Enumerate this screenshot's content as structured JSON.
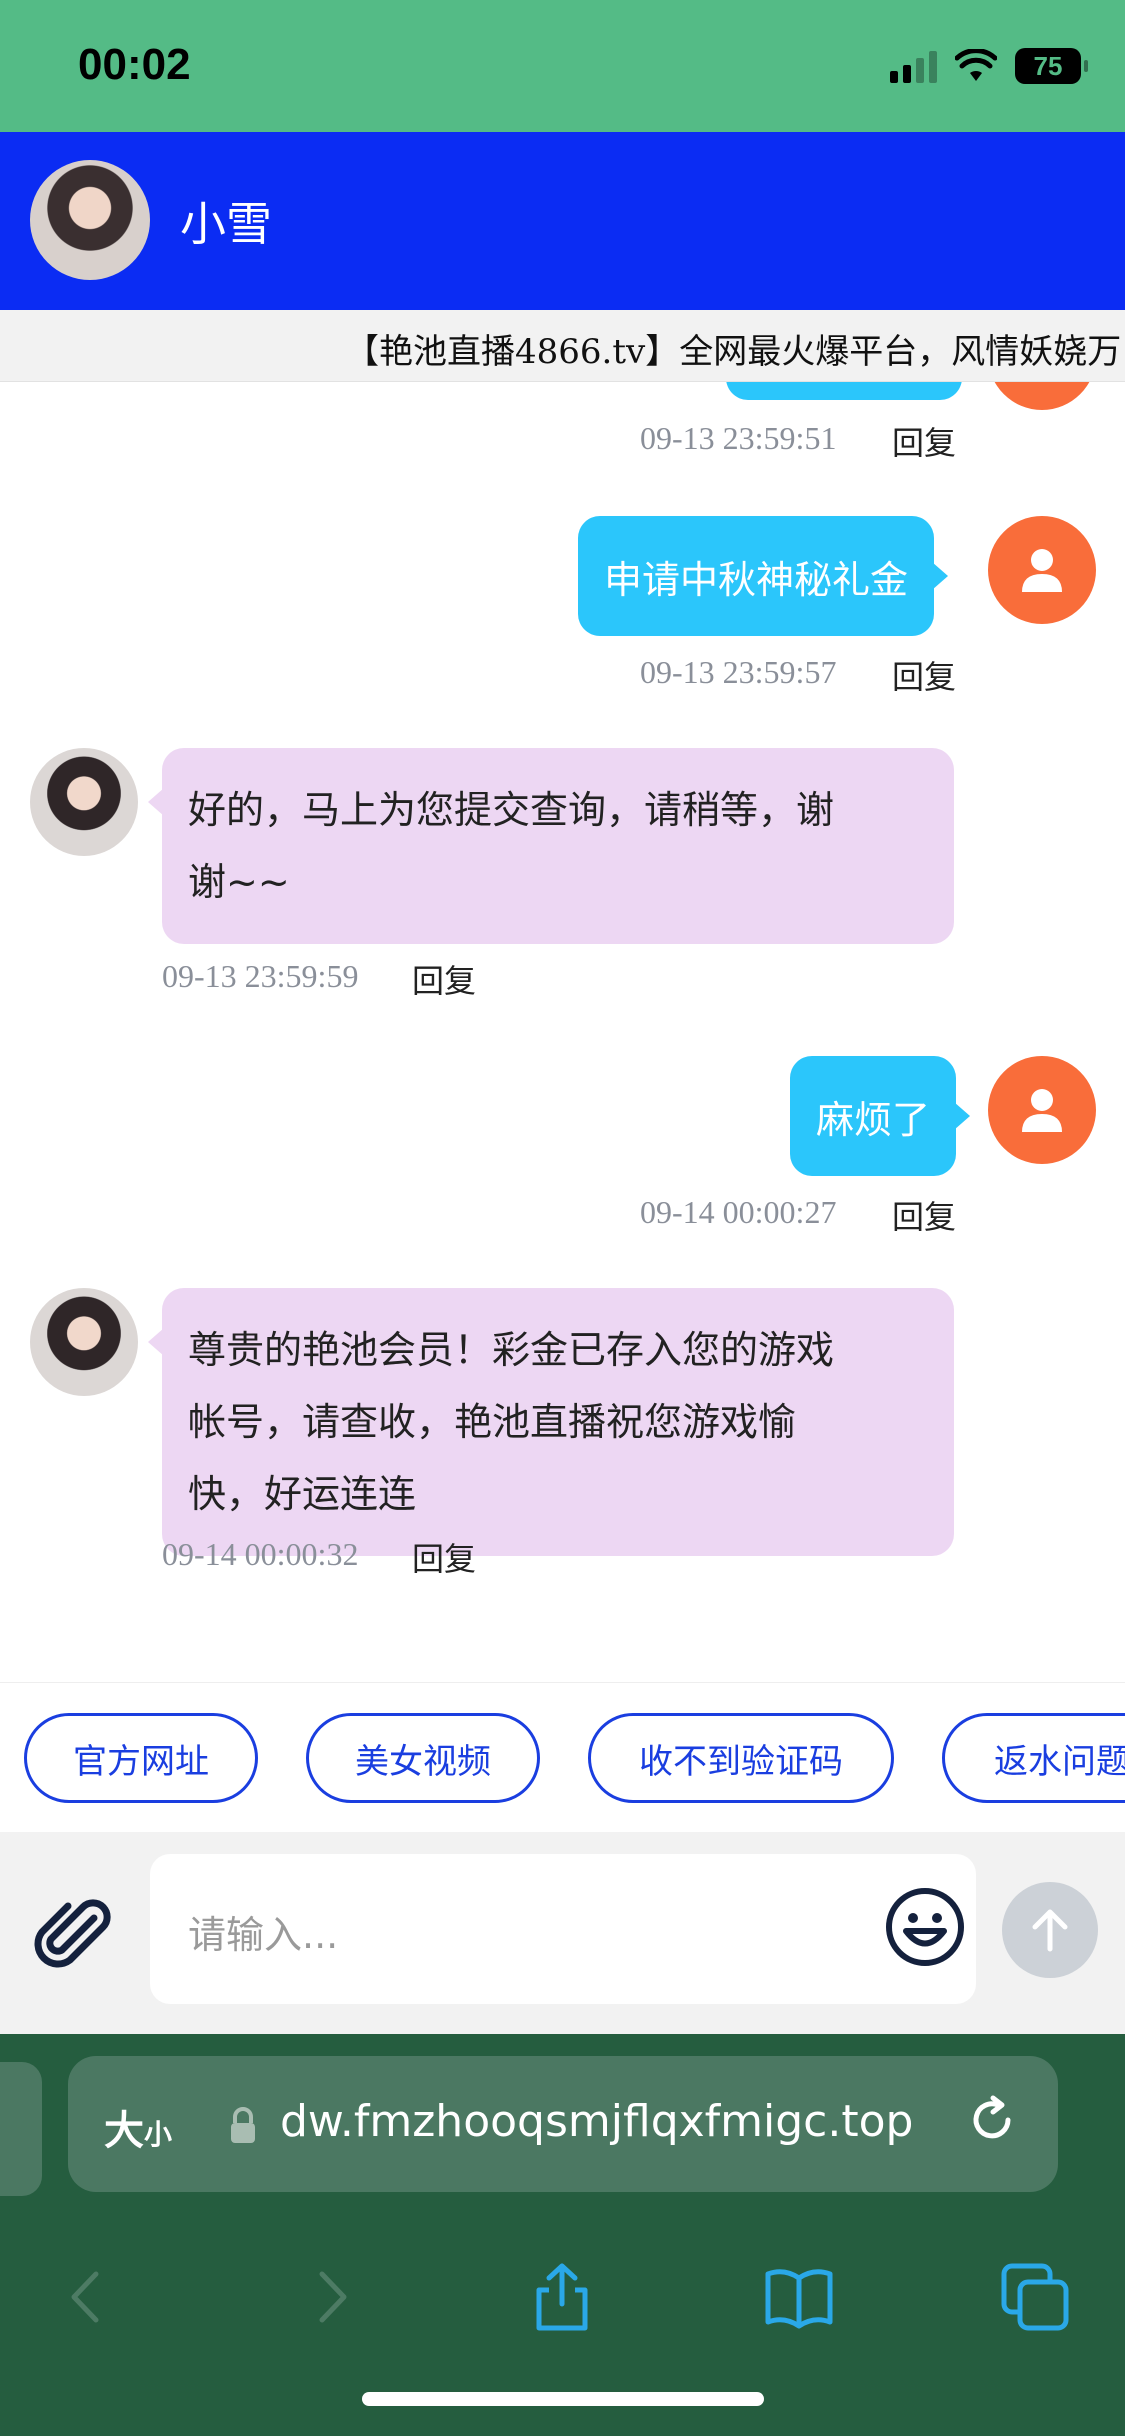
{
  "status_bar": {
    "time": "00:02",
    "battery": "75"
  },
  "header": {
    "contact_name": "小雪"
  },
  "marquee": {
    "text": "【艳池直播4866.tv】全网最火爆平台，风情妖娆万"
  },
  "messages": [
    {
      "direction": "out",
      "text": "",
      "time": "09-13 23:59:51",
      "reply": "回复"
    },
    {
      "direction": "out",
      "text": "申请中秋神秘礼金",
      "time": "09-13 23:59:57",
      "reply": "回复"
    },
    {
      "direction": "in",
      "lines": [
        "好的，马上为您提交查询，请稍等，谢",
        "谢~~"
      ],
      "time": "09-13 23:59:59",
      "reply": "回复"
    },
    {
      "direction": "out",
      "text": "麻烦了",
      "time": "09-14 00:00:27",
      "reply": "回复"
    },
    {
      "direction": "in",
      "lines": [
        "尊贵的艳池会员！彩金已存入您的游戏",
        "帐号，请查收，艳池直播祝您游戏愉",
        "快，好运连连"
      ],
      "time": "09-14 00:00:32",
      "reply": "回复"
    }
  ],
  "quick_replies": [
    "官方网址",
    "美女视频",
    "收不到验证码",
    "返水问题"
  ],
  "composer": {
    "placeholder": "请输入..."
  },
  "browser": {
    "text_size_label_big": "大",
    "text_size_label_small": "小",
    "url": "dw.fmzhooqsmjflqxfmigc.top"
  },
  "icons": {
    "attach": "paperclip-icon",
    "emoji": "smiley-icon",
    "send": "arrow-up-icon",
    "lock": "lock-icon",
    "reload": "reload-icon",
    "back": "chevron-left-icon",
    "forward": "chevron-right-icon",
    "share": "share-icon",
    "bookmarks": "book-icon",
    "tabs": "tabs-icon"
  },
  "colors": {
    "status_bg": "#54bb86",
    "header_bg": "#0b2cf3",
    "out_bubble": "#2bc6fb",
    "in_bubble": "#edd7f3",
    "user_avatar": "#f96d3a",
    "chip_border": "#1a3ee0",
    "browser_bg": "#255d3f"
  }
}
